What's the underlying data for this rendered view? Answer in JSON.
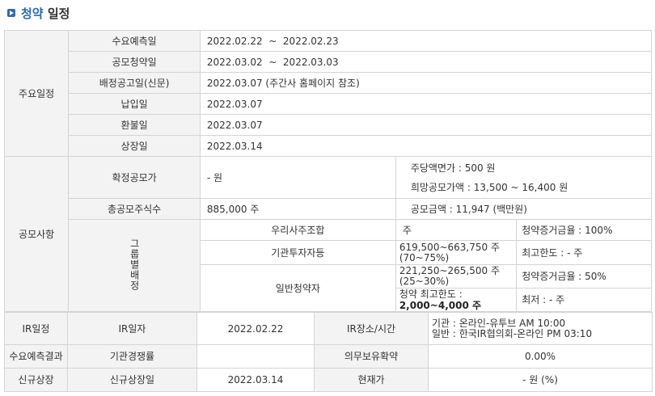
{
  "header": {
    "title_highlight": "청약",
    "title_rest": " 일정"
  },
  "main_schedule": {
    "category": "주요일정",
    "rows": [
      {
        "label": "수요예측일",
        "value": "2022.02.22  ~  2022.02.23"
      },
      {
        "label": "공모청약일",
        "value": "2022.03.02  ~  2022.03.03"
      },
      {
        "label": "배정공고일(신문)",
        "value": "2022.03.07 (주간사 홈페이지 참조)"
      },
      {
        "label": "납입일",
        "value": "2022.03.07"
      },
      {
        "label": "환불일",
        "value": "2022.03.07"
      },
      {
        "label": "상장일",
        "value": "2022.03.14"
      }
    ]
  },
  "offering": {
    "category": "공모사항",
    "fixed_price_label": "확정공모가",
    "fixed_price_value": "- 원",
    "par_value": "주당액면가 :  500 원",
    "hope_price": "희망공모가액 :  13,500 ~ 16,400 원",
    "total_shares_label": "총공모주식수",
    "total_shares_value": "885,000 주",
    "total_amount": "공모금액 : 11,947 (백만원)",
    "group_label": "그룹별배정",
    "groups": [
      {
        "name": "우리사주조합",
        "shares": "주",
        "ratio": "",
        "info1": "청약증거금율 : 100%"
      },
      {
        "name": "기관투자자등",
        "shares": "619,500~663,750 주",
        "ratio": "(70~75%)",
        "info1": "최고한도 :  - 주"
      },
      {
        "name": "일반청약자",
        "shares": "221,250~265,500 주",
        "ratio": "(25~30%)",
        "info1": "청약증거금율 : 50%",
        "limit_label": "청약 최고한도 :",
        "limit_value": "2,000~4,000 주",
        "info2": "최저 :  - 주"
      }
    ]
  },
  "ir": {
    "category": "IR일정",
    "date_label": "IR일자",
    "date_value": "2022.02.22",
    "place_label": "IR장소/시간",
    "place_line1": "기관 : 온라인-유투브 AM 10:00",
    "place_line2": "일반 : 한국IR협의회-온라인 PM 03:10"
  },
  "demand": {
    "category": "수요예측결과",
    "competition_label": "기관경쟁률",
    "competition_value": "",
    "lockup_label": "의무보유확약",
    "lockup_value": "0.00%"
  },
  "listing": {
    "category": "신규상장",
    "date_label": "신규상장일",
    "date_value": "2022.03.14",
    "price_label": "현재가",
    "price_value": "- 원 (%)"
  }
}
